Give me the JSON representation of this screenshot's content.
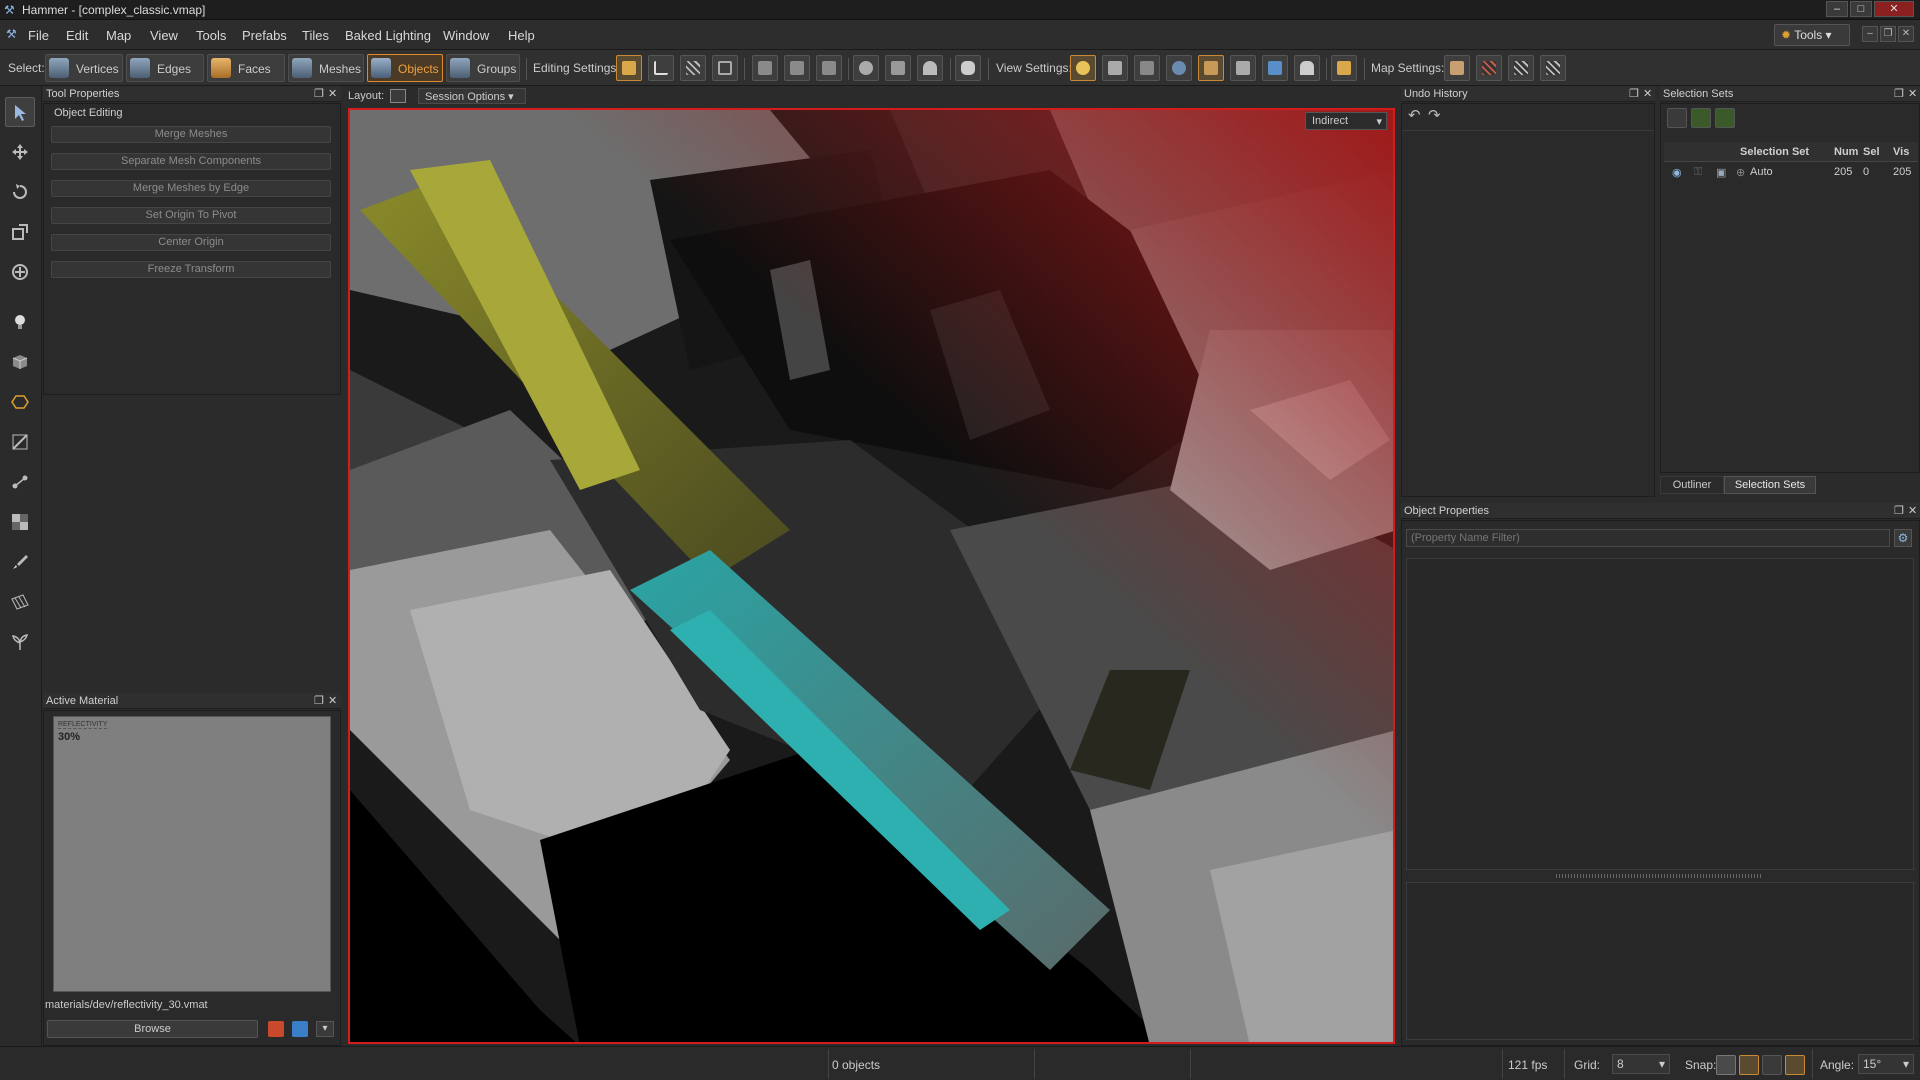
{
  "app": {
    "title": "Hammer - [complex_classic.vmap]"
  },
  "menu": [
    "File",
    "Edit",
    "Map",
    "View",
    "Tools",
    "Prefabs",
    "Tiles",
    "Baked Lighting",
    "Window",
    "Help"
  ],
  "tools_button": "Tools",
  "toolbar": {
    "select_label": "Select:",
    "select_modes": [
      "Vertices",
      "Edges",
      "Faces",
      "Meshes",
      "Objects",
      "Groups"
    ],
    "active_mode": "Objects",
    "editing_settings_label": "Editing Settings:",
    "view_settings_label": "View Settings:",
    "map_settings_label": "Map Settings:"
  },
  "tool_properties": {
    "header": "Tool Properties",
    "section": "Object Editing",
    "buttons": [
      "Merge Meshes",
      "Separate Mesh Components",
      "Merge Meshes by Edge",
      "Set Origin To Pivot",
      "Center Origin",
      "Freeze Transform"
    ]
  },
  "active_material": {
    "header": "Active Material",
    "thumb_title": "REFLECTIVITY",
    "thumb_value": "30%",
    "path": "materials/dev/reflectivity_30.vmat",
    "browse": "Browse"
  },
  "layout_bar": {
    "layout_label": "Layout:",
    "session_options": "Session Options"
  },
  "viewport": {
    "render_mode": "Indirect"
  },
  "undo_history": {
    "header": "Undo History"
  },
  "selection_sets": {
    "header": "Selection Sets",
    "columns": [
      "Selection Set",
      "Num",
      "Sel",
      "Vis"
    ],
    "rows": [
      {
        "name": "Auto",
        "num": "205",
        "sel": "0",
        "vis": "205"
      }
    ],
    "tabs": [
      "Outliner",
      "Selection Sets"
    ],
    "active_tab": "Selection Sets"
  },
  "object_properties": {
    "header": "Object Properties",
    "filter_placeholder": "(Property Name Filter)"
  },
  "status": {
    "objects": "0 objects",
    "fps": "121 fps",
    "grid_label": "Grid:",
    "grid_value": "8",
    "snap_label": "Snap:",
    "angle_label": "Angle:",
    "angle_value": "15°"
  },
  "colors": {
    "accent_orange": "#e08a2a",
    "viewport_border": "#d41c1c",
    "panel_bg": "#2a2a2a"
  }
}
